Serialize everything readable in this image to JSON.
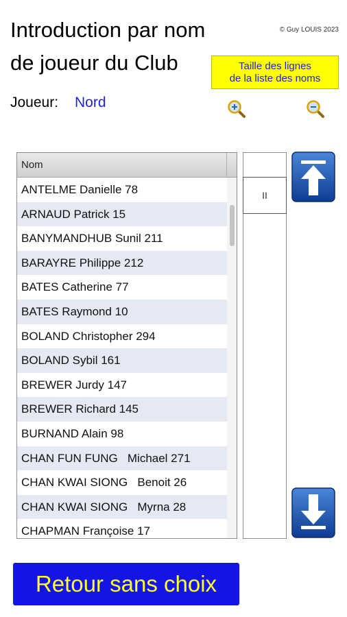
{
  "header": {
    "title_line1": "Introduction par nom",
    "title_line2": "de joueur du Club",
    "copyright": "© Guy LOUIS 2023"
  },
  "line_size": {
    "label_line1": "Taille des lignes",
    "label_line2": "de la liste des noms",
    "zoom_in_icon": "zoom-in-icon",
    "zoom_out_icon": "zoom-out-icon"
  },
  "player": {
    "label": "Joueur:",
    "value": "Nord"
  },
  "list": {
    "column_header": "Nom",
    "rows": [
      "ANTELME Danielle 78",
      "ARNAUD Patrick 15",
      "BANYMANDHUB Sunil 211",
      "BARAYRE Philippe 212",
      "BATES Catherine 77",
      "BATES Raymond 10",
      "BOLAND Christopher 294",
      "BOLAND Sybil 161",
      "BREWER Jurdy 147",
      "BREWER Richard 145",
      "BURNAND Alain 98",
      "CHAN FUN FUNG   Michael 271",
      "CHAN KWAI SIONG   Benoit 26",
      "CHAN KWAI SIONG   Myrna 28",
      "CHAPMAN Françoise 17"
    ]
  },
  "side": {
    "pause_label": "II"
  },
  "buttons": {
    "return_label": "Retour sans choix"
  },
  "colors": {
    "accent_blue": "#1414e6",
    "button_text_yellow": "#ffff2a",
    "size_box_yellow": "#ffff00",
    "player_blue": "#1f1fe0",
    "row_stripe": "#e4e9f4"
  }
}
